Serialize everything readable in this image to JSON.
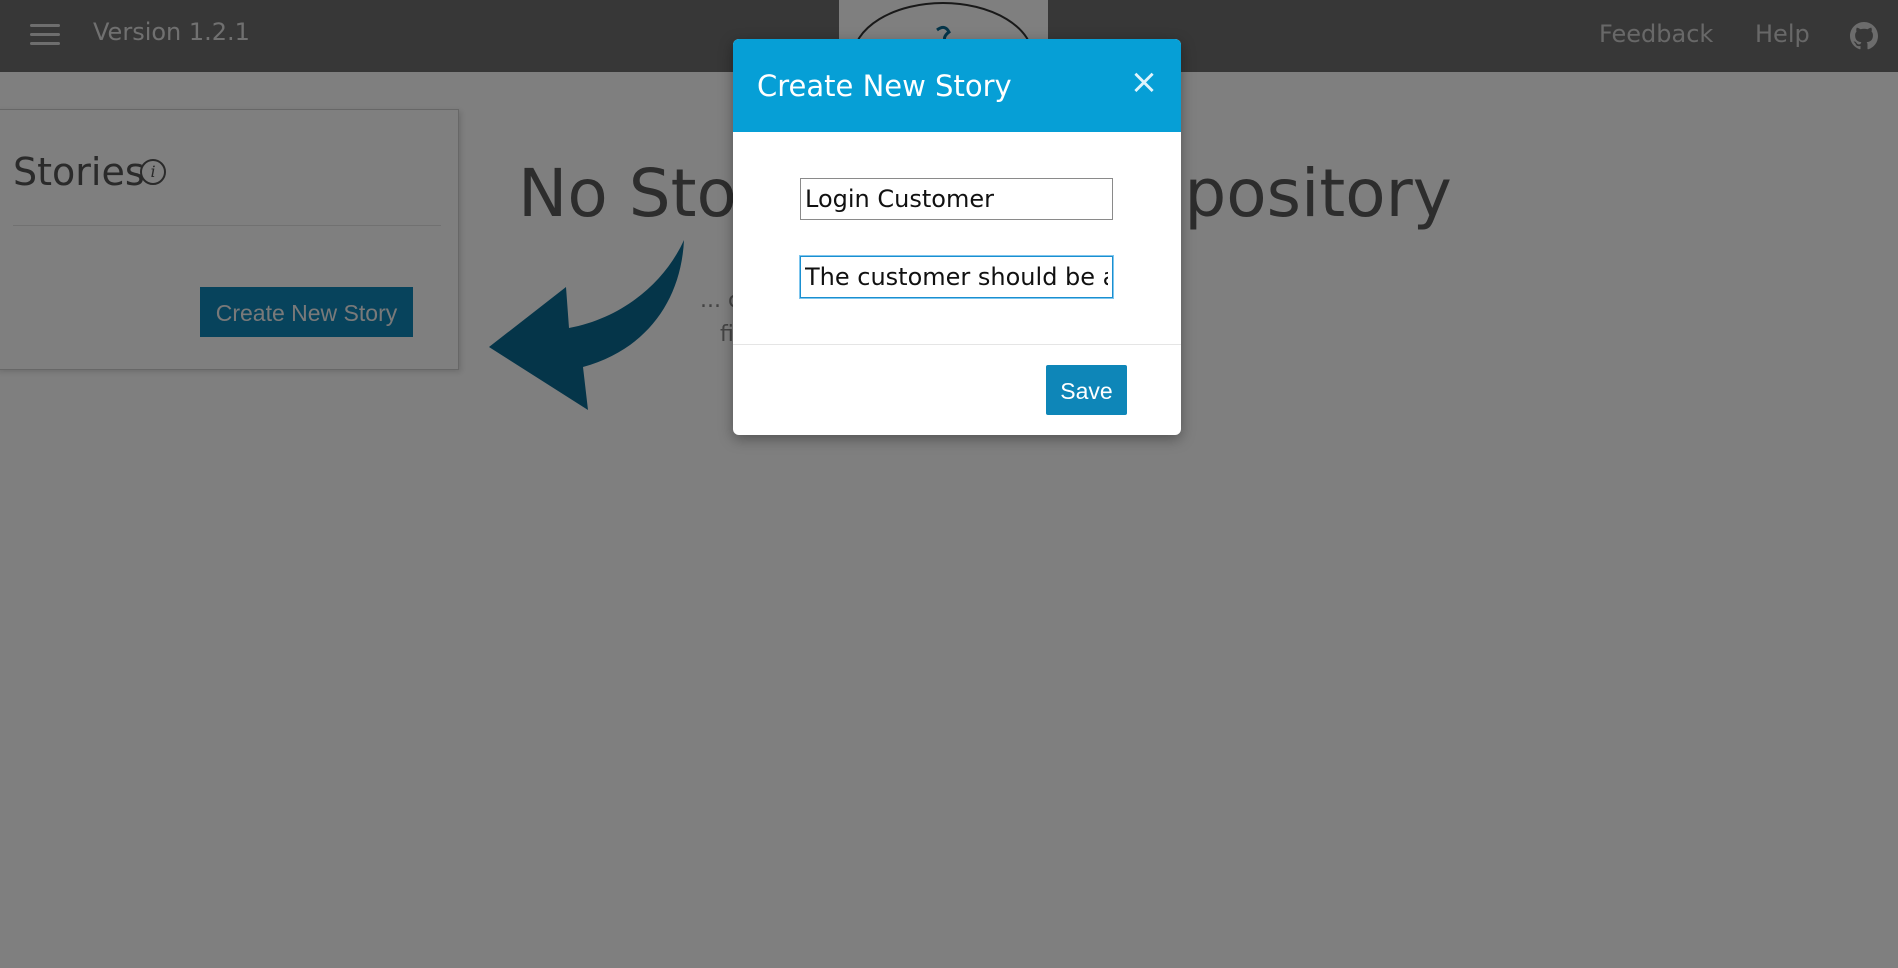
{
  "header": {
    "version": "Version 1.2.1",
    "links": {
      "feedback": "Feedback",
      "help": "Help"
    },
    "icons": {
      "menu": "hamburger-menu-icon",
      "github": "github-icon",
      "logo": "app-logo"
    }
  },
  "sidebar": {
    "title": "Stories",
    "info_icon": "i",
    "create_button": "Create New Story"
  },
  "main": {
    "empty_heading": "No Stories in this Repository",
    "empty_sub_line1": "... c",
    "empty_sub_line2": "fi"
  },
  "modal": {
    "title": "Create New Story",
    "close": "×",
    "fields": {
      "title_value": "Login Customer",
      "description_value": "The customer should be ab"
    },
    "save_button": "Save"
  },
  "colors": {
    "header_bg": "#6f6f6f",
    "modal_header_bg": "#069fd6",
    "primary_button": "#0e86b8",
    "arrow": "#0b6a93"
  }
}
